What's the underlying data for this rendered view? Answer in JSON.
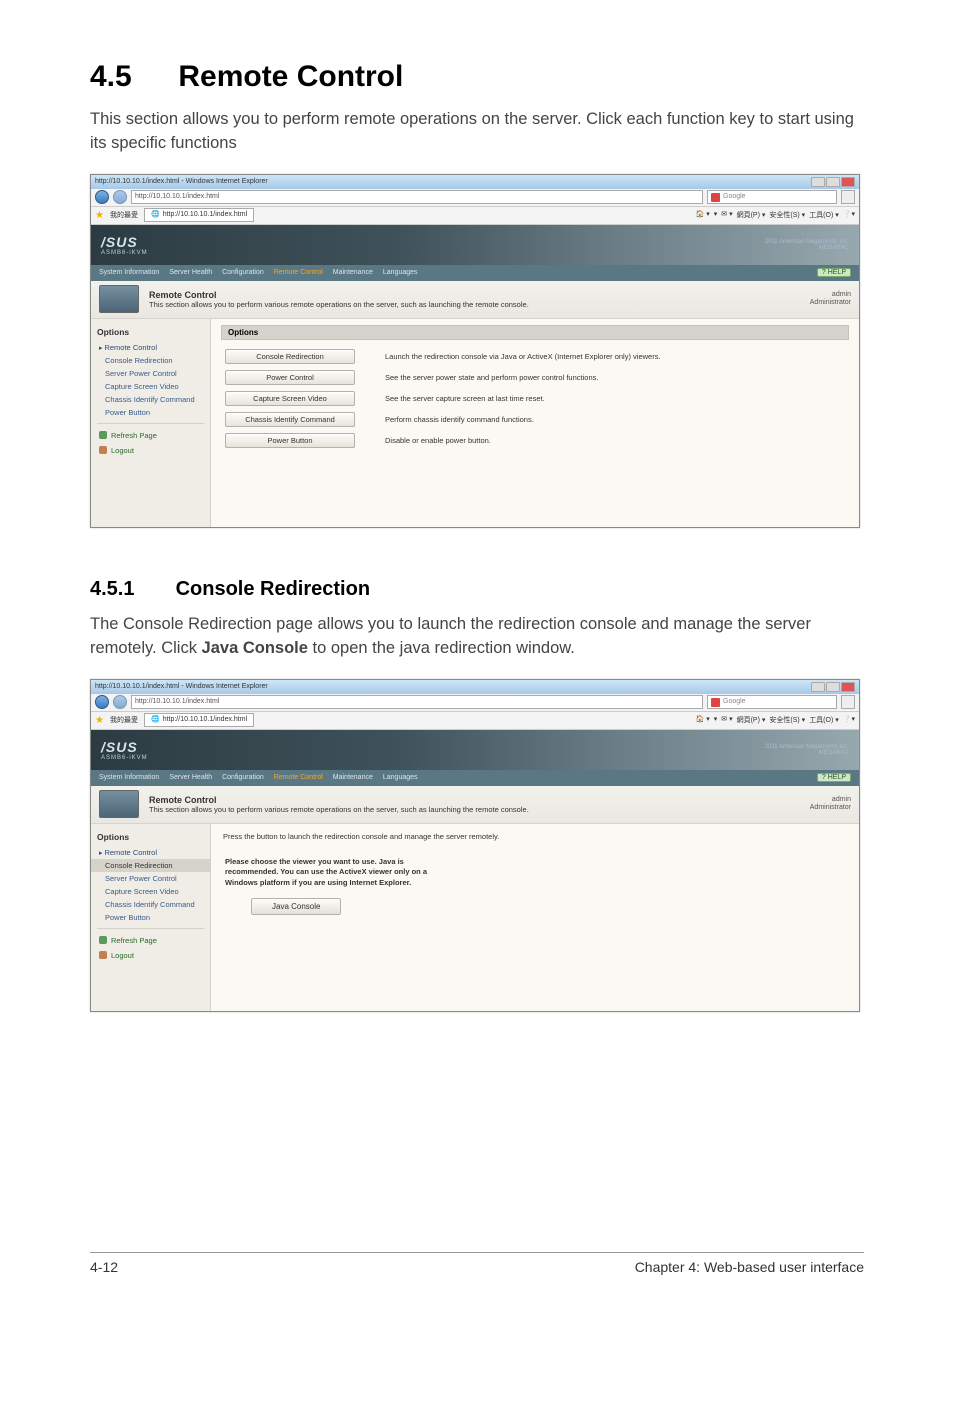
{
  "doc": {
    "section_num": "4.5",
    "section_title": "Remote Control",
    "section_intro": "This section allows you to perform remote operations on the server. Click each function key to start using its specific functions",
    "subsection_num": "4.5.1",
    "subsection_title": "Console Redirection",
    "subsection_intro_pre": "The Console Redirection page allows you to launch the redirection console and manage the server remotely. Click ",
    "subsection_intro_bold": "Java Console",
    "subsection_intro_post": " to open the java redirection window.",
    "footer_left": "4-12",
    "footer_right": "Chapter 4: Web-based user interface"
  },
  "browser": {
    "window_title": "http://10.10.10.1/index.html - Windows Internet Explorer",
    "url": "http://10.10.10.1/index.html",
    "search_placeholder": "Google",
    "fav_label": "我的最愛",
    "tab_label": "http://10.10.10.1/index.html",
    "tool_items": [
      "網頁(P) ▾",
      "安全性(S) ▾",
      "工具(O) ▾"
    ]
  },
  "brand": {
    "logo": "/SUS",
    "sublogo": "ASMB6-iKVM",
    "tm_line1": "2011 American Megatrends Inc.",
    "tm_line2": "MEGARAC"
  },
  "menubar": {
    "items": [
      "System Information",
      "Server Health",
      "Configuration",
      "Remote Control",
      "Maintenance",
      "Languages"
    ],
    "active_index": 3,
    "help": "? HELP"
  },
  "header": {
    "title": "Remote Control",
    "desc": "This section allows you to perform various remote operations on the server, such as launching the remote console.",
    "user": "admin",
    "role": "Administrator"
  },
  "sidebar": {
    "title": "Options",
    "parent": "Remote Control",
    "items": [
      "Console Redirection",
      "Server Power Control",
      "Capture Screen Video",
      "Chassis Identify Command",
      "Power Button"
    ],
    "refresh": "Refresh Page",
    "logout": "Logout"
  },
  "screenshot1": {
    "options_label": "Options",
    "rows": [
      {
        "btn": "Console Redirection",
        "desc": "Launch the redirection console via Java or ActiveX (Internet Explorer only) viewers."
      },
      {
        "btn": "Power Control",
        "desc": "See the server power state and perform power control functions."
      },
      {
        "btn": "Capture Screen Video",
        "desc": "See the server capture screen at last time reset."
      },
      {
        "btn": "Chassis Identify Command",
        "desc": "Perform chassis identify command functions."
      },
      {
        "btn": "Power Button",
        "desc": "Disable or enable power button."
      }
    ]
  },
  "screenshot2": {
    "sidebar_selected_index": 0,
    "intro": "Press the button to launch the redirection console and manage the server remotely.",
    "note_l1": "Please choose the viewer you want to use. Java is",
    "note_l2": "recommended. You can use the ActiveX viewer only on a",
    "note_l3": "Windows platform if you are using Internet Explorer.",
    "java_btn": "Java Console"
  }
}
